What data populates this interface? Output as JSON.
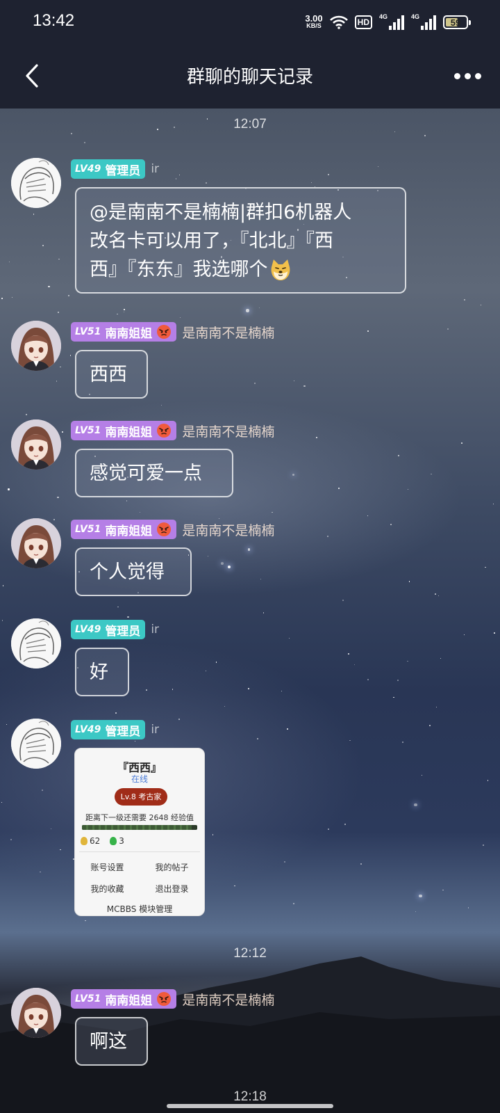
{
  "status_bar": {
    "time": "13:42",
    "net_speed_value": "3.00",
    "net_speed_unit": "KB/S",
    "hd": "HD",
    "sim1": "4G",
    "sim2": "4G",
    "battery": "59",
    "battery_level": 0.59
  },
  "header": {
    "title": "群聊的聊天记录"
  },
  "chat": {
    "timestamps": [
      "12:07",
      "12:12",
      "12:18"
    ],
    "messages": [
      {
        "level": "LV49",
        "role": "管理员",
        "nickname": "ir",
        "text": "@是南南不是楠楠|群扣6机器人改名卡可以用了，『北北』『西西』『东东』我选哪个"
      },
      {
        "level": "LV51",
        "role": "南南姐姐",
        "nickname": "是南南不是楠楠",
        "text": "西西"
      },
      {
        "level": "LV51",
        "role": "南南姐姐",
        "nickname": "是南南不是楠楠",
        "text": "感觉可爱一点"
      },
      {
        "level": "LV51",
        "role": "南南姐姐",
        "nickname": "是南南不是楠楠",
        "text": "个人觉得"
      },
      {
        "level": "LV49",
        "role": "管理员",
        "nickname": "ir",
        "text": "好"
      },
      {
        "level": "LV49",
        "role": "管理员",
        "nickname": "ir"
      },
      {
        "level": "LV51",
        "role": "南南姐姐",
        "nickname": "是南南不是楠楠",
        "text": "啊这"
      }
    ],
    "message_1_line1": "@是南南不是楠楠|群扣6机器人",
    "message_1_line2": "改名卡可以用了，『北北』『西",
    "message_1_line3": "西』『东东』我选哪个"
  },
  "card": {
    "title": "『西西』",
    "status": "在线",
    "level": "Lv.8 考古家",
    "exp_text": "距离下一级还需要 2648 经验值",
    "exp_progress": 0.95,
    "gold": "62",
    "gems": "3",
    "links": [
      "账号设置",
      "我的帖子",
      "我的收藏",
      "退出登录"
    ],
    "footer": "MCBBS 模块管理"
  }
}
